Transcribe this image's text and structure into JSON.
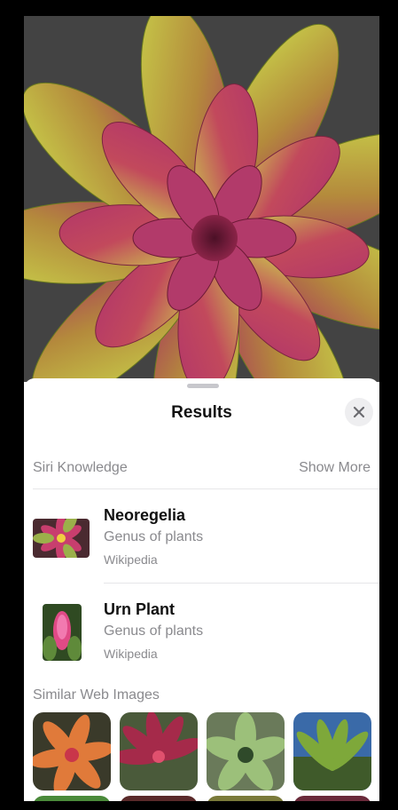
{
  "sheet": {
    "title": "Results",
    "close_icon": "close-icon"
  },
  "siri_knowledge": {
    "label": "Siri Knowledge",
    "show_more": "Show More",
    "results": [
      {
        "name": "Neoregelia",
        "description": "Genus of plants",
        "source": "Wikipedia"
      },
      {
        "name": "Urn Plant",
        "description": "Genus of plants",
        "source": "Wikipedia"
      }
    ]
  },
  "similar_web_images": {
    "label": "Similar Web Images"
  },
  "colors": {
    "accent_green": "#b7c93a",
    "accent_magenta": "#b0326a",
    "secondary_text": "#8a8a8e"
  }
}
